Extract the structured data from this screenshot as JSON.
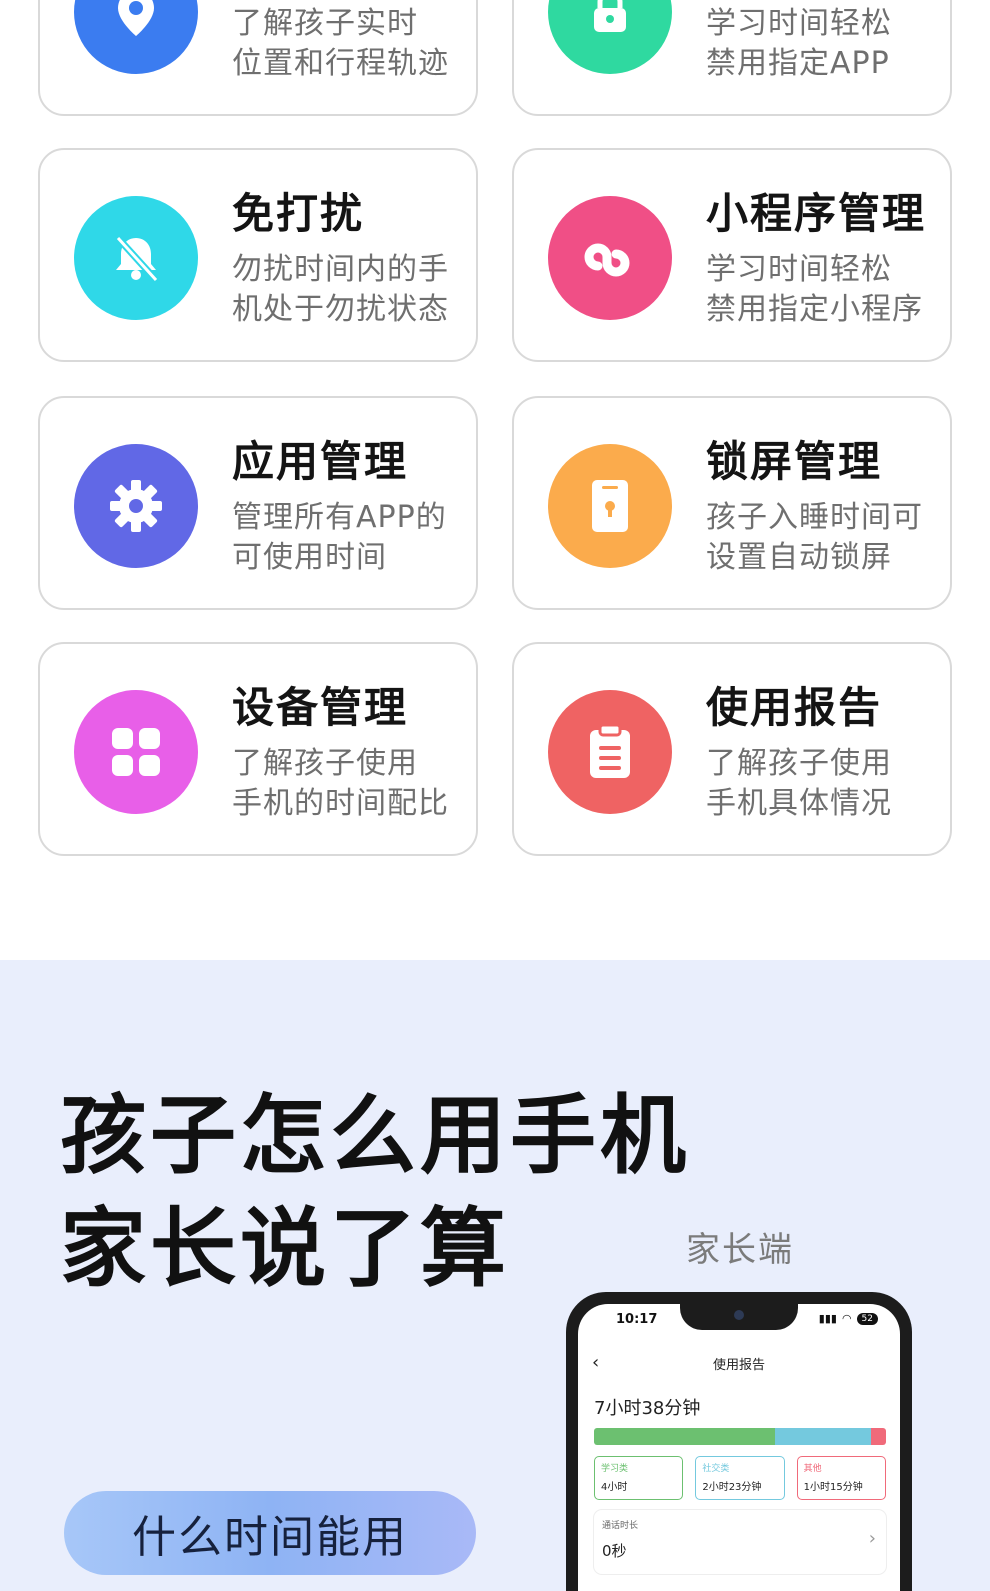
{
  "features": [
    {
      "title": "",
      "desc": [
        "了解孩子实时",
        "位置和行程轨迹"
      ],
      "icon": "location-pin-icon",
      "color": "#3b7cf0"
    },
    {
      "title": "",
      "desc": [
        "学习时间轻松",
        "禁用指定APP"
      ],
      "icon": "lock-icon",
      "color": "#2fd9a0"
    },
    {
      "title": "免打扰",
      "desc": [
        "勿扰时间内的手",
        "机处于勿扰状态"
      ],
      "icon": "bell-off-icon",
      "color": "#2fd8e8"
    },
    {
      "title": "小程序管理",
      "desc": [
        "学习时间轻松",
        "禁用指定小程序"
      ],
      "icon": "mini-program-icon",
      "color": "#f04f86"
    },
    {
      "title": "应用管理",
      "desc": [
        "管理所有APP的",
        "可使用时间"
      ],
      "icon": "gear-icon",
      "color": "#6168e6"
    },
    {
      "title": "锁屏管理",
      "desc": [
        "孩子入睡时间可",
        "设置自动锁屏"
      ],
      "icon": "lock-screen-icon",
      "color": "#fbab4c"
    },
    {
      "title": "设备管理",
      "desc": [
        "了解孩子使用",
        "手机的时间配比"
      ],
      "icon": "grid-icon",
      "color": "#e85fe8"
    },
    {
      "title": "使用报告",
      "desc": [
        "了解孩子使用",
        "手机具体情况"
      ],
      "icon": "clipboard-icon",
      "color": "#ef6363"
    }
  ],
  "promo": {
    "headline_line1": "孩子怎么用手机",
    "headline_line2": "家长说了算",
    "side_label": "家长端",
    "button_label": "什么时间能用"
  },
  "phone": {
    "time": "10:17",
    "battery": "52",
    "page_title": "使用报告",
    "total_time": "7小时38分钟",
    "bar": [
      {
        "share": 0.62,
        "color": "#6cc070"
      },
      {
        "share": 0.33,
        "color": "#74c9de"
      },
      {
        "share": 0.05,
        "color": "#f06a7a"
      }
    ],
    "categories": [
      {
        "name": "学习类",
        "value": "4小时",
        "color": "#6cc070"
      },
      {
        "name": "社交类",
        "value": "2小时23分钟",
        "color": "#74c9de"
      },
      {
        "name": "其他",
        "value": "1小时15分钟",
        "color": "#f06a7a"
      }
    ],
    "call_label": "通话时长",
    "call_value": "0秒"
  }
}
